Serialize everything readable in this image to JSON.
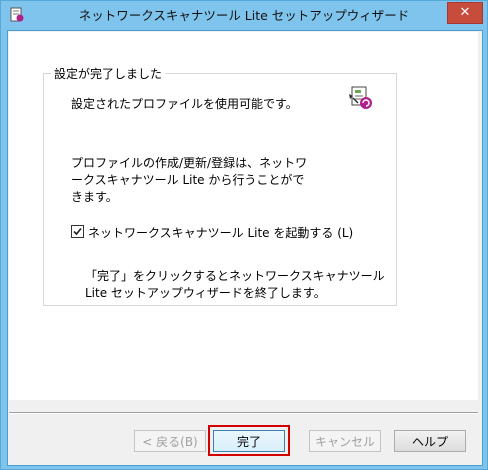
{
  "window": {
    "title": "ネットワークスキャナツール Lite セットアップウィザード",
    "close_glyph": "✕"
  },
  "group": {
    "title": "設定が完了しました"
  },
  "messages": {
    "line1": "設定されたプロファイルを使用可能です。",
    "line2": "プロファイルの作成/更新/登録は、ネットワークスキャナツール Lite から行うことができます。",
    "line3": "「完了」をクリックするとネットワークスキャナツール Lite セットアップウィザードを終了します。"
  },
  "checkbox": {
    "label": "ネットワークスキャナツール Lite を起動する (L)",
    "checked": true
  },
  "buttons": {
    "back": "< 戻る(B)",
    "finish": "完了",
    "cancel": "キャンセル",
    "help": "ヘルプ"
  },
  "colors": {
    "titlebar": "#7fc4ec",
    "close": "#c84c3c",
    "highlight": "#d40000"
  }
}
